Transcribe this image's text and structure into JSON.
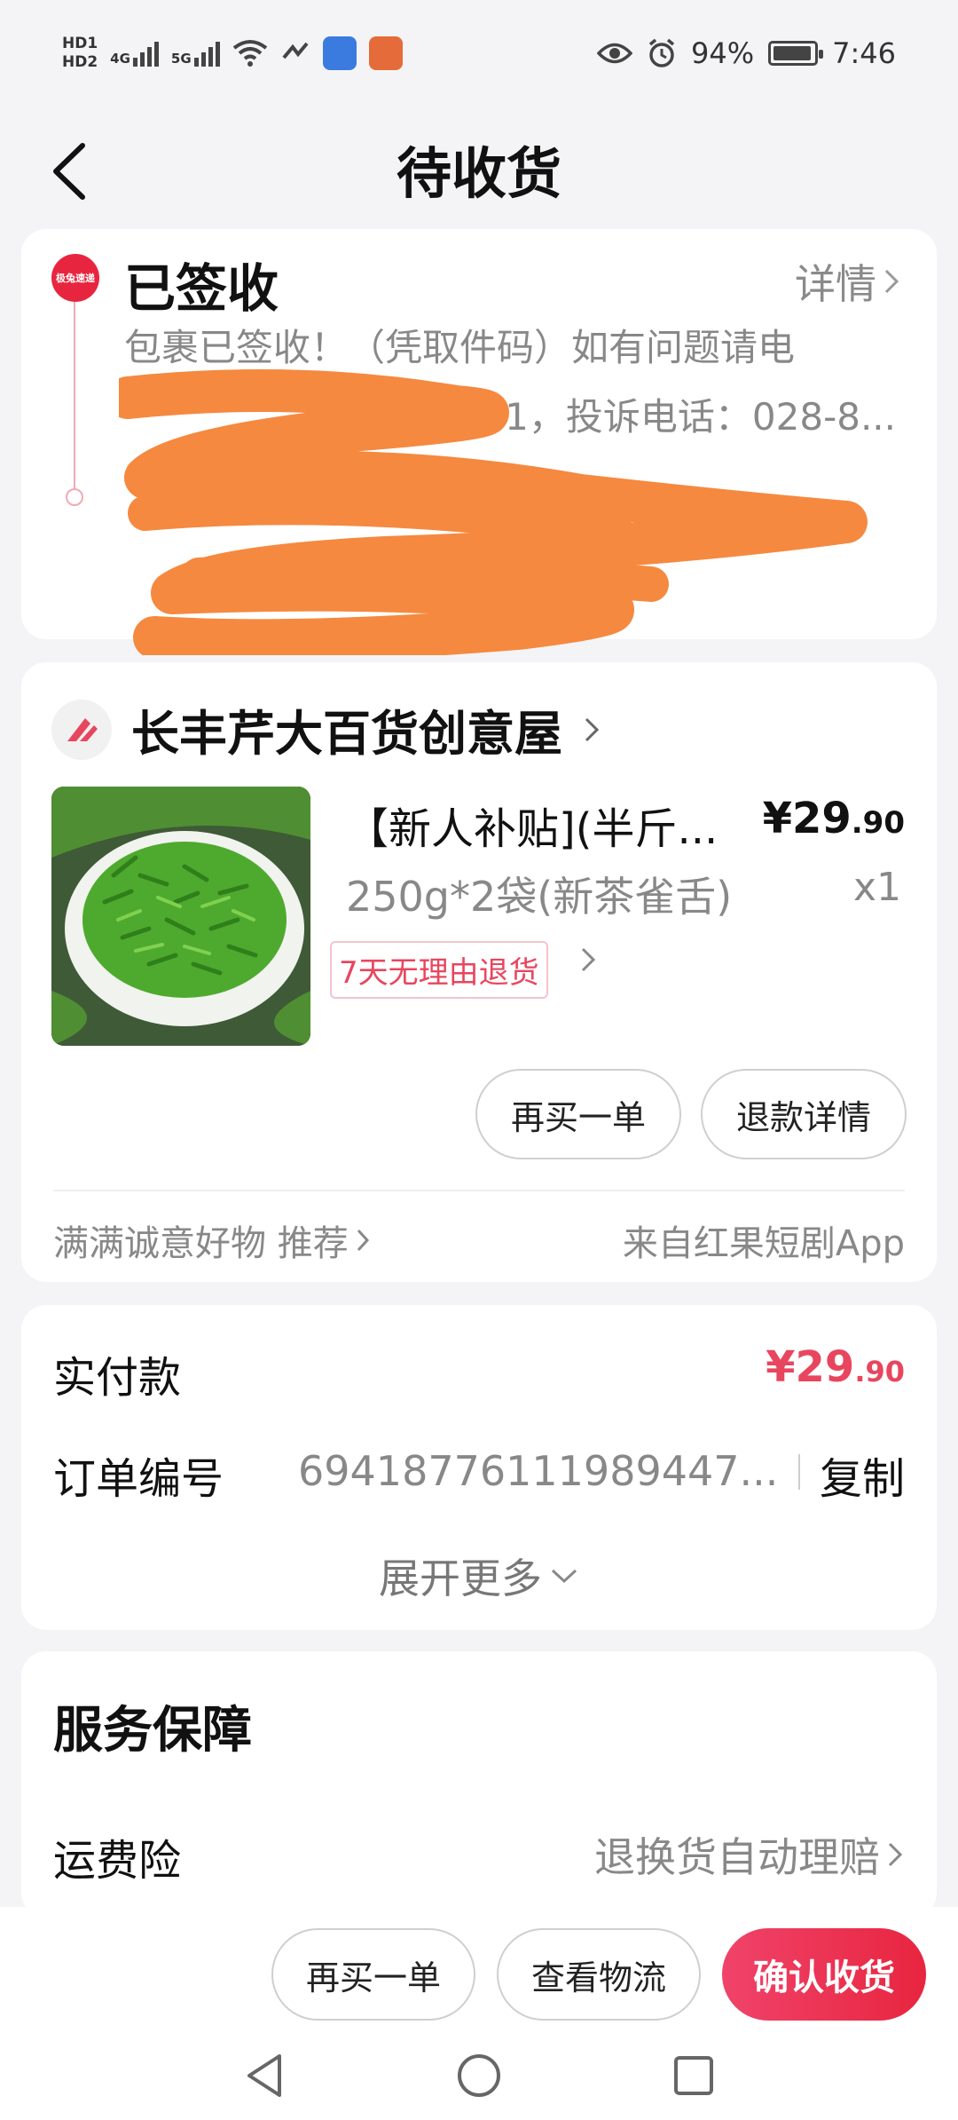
{
  "status_bar": {
    "hd1": "HD1",
    "hd2": "HD2",
    "net1": "4G",
    "net2": "5G",
    "battery": "94%",
    "time": "7:46",
    "icons": [
      "eye-icon",
      "alarm-icon",
      "wifi-icon"
    ]
  },
  "header": {
    "title": "待收货",
    "back_icon": "chevron-left-icon"
  },
  "shipment": {
    "carrier_badge": "极兔速递",
    "status": "已签收",
    "detail_label": "详情",
    "desc_line1": "包裹已签收！（凭取件码）如有问题请电",
    "desc_line2": "2461，投诉电话：028-8..."
  },
  "store": {
    "name": "长丰芹大百货创意屋",
    "product": {
      "title": "【新人补贴](半斤...",
      "price_main": "¥29",
      "price_decimal": ".90",
      "spec": "250g*2袋(新茶雀舌)",
      "qty": "x1",
      "return_tag": "7天无理由退货"
    },
    "buttons": {
      "buy_again": "再买一单",
      "refund_detail": "退款详情"
    },
    "recommend": "满满诚意好物 推荐",
    "source": "来自红果短剧App"
  },
  "payment": {
    "paid_label": "实付款",
    "paid_main": "¥29",
    "paid_decimal": ".90",
    "order_label": "订单编号",
    "order_no": "6941877611198944​7...",
    "copy_label": "复制",
    "expand_label": "展开更多"
  },
  "service": {
    "title": "服务保障",
    "item_label": "运费险",
    "item_value": "退换货自动理赔"
  },
  "bottom": {
    "buy_again": "再买一单",
    "logistics": "查看物流",
    "confirm": "确认收货"
  },
  "colors": {
    "accent": "#e8253f",
    "price_red": "#e8465e",
    "redaction": "#f5893f"
  }
}
